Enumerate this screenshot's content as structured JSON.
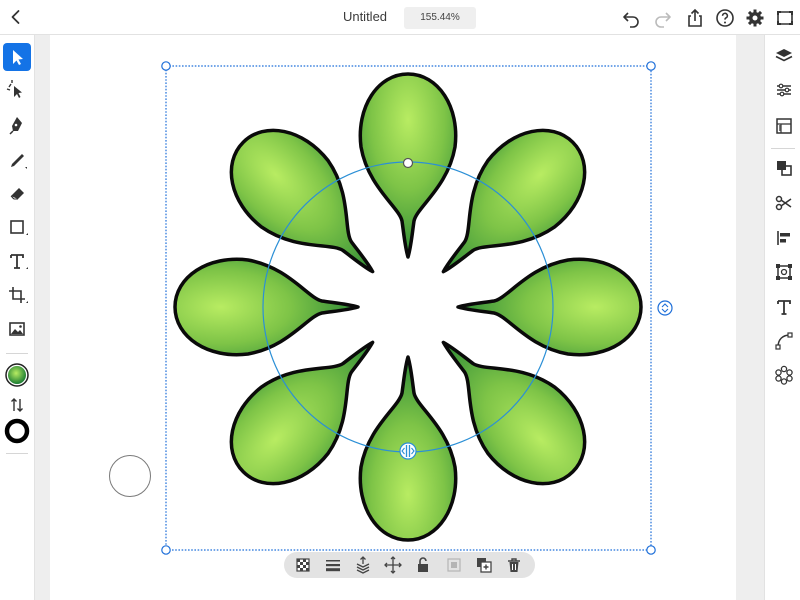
{
  "header": {
    "title": "Untitled",
    "zoom": "155.44%",
    "icons": [
      "chevron-left-icon",
      "undo-icon",
      "redo-icon",
      "share-icon",
      "help-icon",
      "settings-icon",
      "fullscreen-icon"
    ]
  },
  "left_toolbar": {
    "tools": [
      "selection-tool",
      "direct-selection-tool",
      "pen-tool",
      "pencil-tool",
      "eraser-tool",
      "shape-tool",
      "type-tool",
      "crop-tool",
      "image-tool"
    ],
    "active_tool": "selection-tool",
    "fill_color": "#4caf2f",
    "stroke_color": "#000000"
  },
  "right_toolbar": {
    "tools": [
      "layers-icon",
      "properties-icon",
      "libraries-icon",
      "combine-icon",
      "scissors-icon",
      "align-icon",
      "transform-icon",
      "type-panel-icon",
      "path-icon",
      "repeat-icon"
    ]
  },
  "canvas": {
    "artwork": "radial repeat of eight green teardrop shapes",
    "petal_count": 8,
    "gradient_inner": "#b8ec62",
    "gradient_outer": "#197c32",
    "stroke": "#0a0a0a",
    "selection_color": "#1e6fd9",
    "guide_color": "#2b8fd6"
  },
  "action_bar": {
    "icons": [
      "opacity-icon",
      "stroke-weight-icon",
      "arrange-icon",
      "move-icon",
      "unlock-icon",
      "disabled-icon",
      "duplicate-icon",
      "trash-icon"
    ]
  },
  "colors": {
    "accent": "#1473e6",
    "panel_bg": "#ffffff",
    "canvas_bg": "#eeeeee"
  }
}
